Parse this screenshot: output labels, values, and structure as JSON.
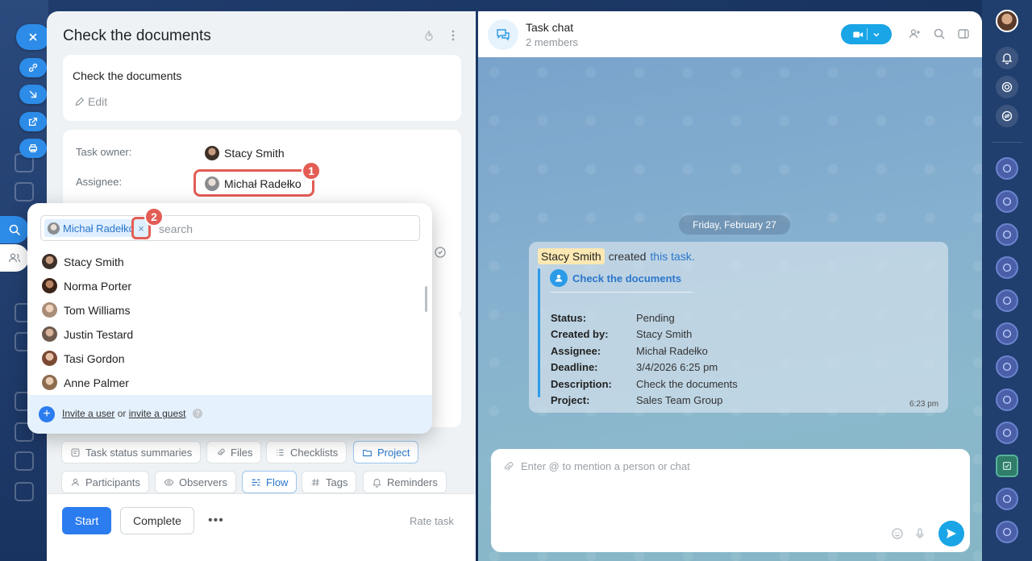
{
  "task": {
    "title": "Check the documents",
    "description": "Check the documents",
    "edit_label": "Edit",
    "owner_label": "Task owner:",
    "owner_name": "Stacy Smith",
    "assignee_label": "Assignee:",
    "assignee_name": "Michał Radełko",
    "callout_1": "1",
    "callout_2": "2"
  },
  "popup": {
    "selected_name": "Michał Radełko",
    "remove_label": "×",
    "search_placeholder": "search",
    "users": [
      {
        "name": "Stacy Smith"
      },
      {
        "name": "Norma Porter"
      },
      {
        "name": "Tom Williams"
      },
      {
        "name": "Justin Testard"
      },
      {
        "name": "Tasi Gordon"
      },
      {
        "name": "Anne Palmer"
      }
    ],
    "invite_user": "Invite a user",
    "invite_or": "or",
    "invite_guest": "invite a guest",
    "help": "?"
  },
  "chips": {
    "row1": [
      "Task status summaries",
      "Files",
      "Checklists",
      "Project"
    ],
    "row2": [
      "Participants",
      "Observers",
      "Flow",
      "Tags",
      "Reminders"
    ]
  },
  "footer": {
    "start": "Start",
    "complete": "Complete",
    "more": "•••",
    "rate": "Rate task"
  },
  "chat": {
    "title": "Task chat",
    "members": "2 members",
    "date": "Friday, February 27",
    "msg_author": "Stacy Smith",
    "msg_created": "created",
    "msg_link": "this task.",
    "task_title": "Check the documents",
    "details": [
      {
        "label": "Status:",
        "value": "Pending"
      },
      {
        "label": "Created by:",
        "value": "Stacy Smith"
      },
      {
        "label": "Assignee:",
        "value": "Michał Radełko"
      },
      {
        "label": "Deadline:",
        "value": "3/4/2026 6:25 pm"
      },
      {
        "label": "Description:",
        "value": "Check the documents"
      },
      {
        "label": "Project:",
        "value": "Sales Team Group"
      }
    ],
    "time": "6:23 pm",
    "compose_placeholder": "Enter @ to mention a person or chat"
  },
  "colors": {
    "accent": "#2b7cef",
    "callout": "#e35d55",
    "chat_accent": "#19a5e6"
  }
}
